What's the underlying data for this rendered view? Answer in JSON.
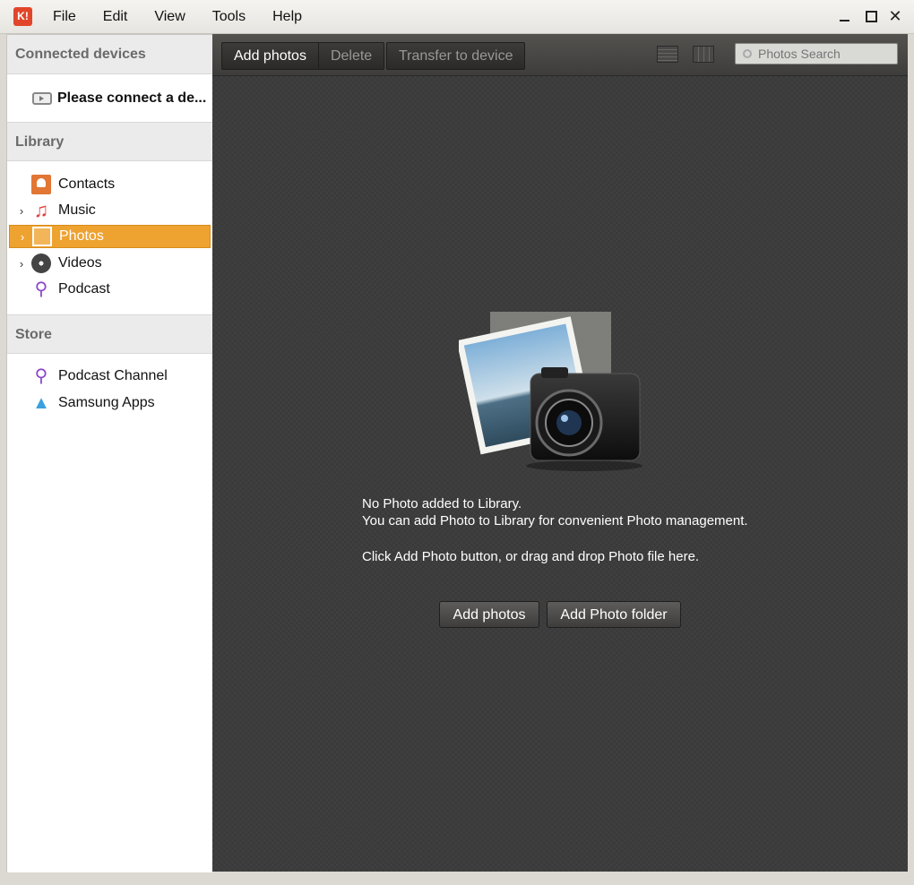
{
  "app": {
    "logo_text": "K!",
    "logo_color": "#e2462a"
  },
  "menu": [
    "File",
    "Edit",
    "View",
    "Tools",
    "Help"
  ],
  "window_controls": {
    "close_glyph": "✕"
  },
  "sidebar": {
    "connected_devices": {
      "header": "Connected devices",
      "device_label": "Please connect a de..."
    },
    "library": {
      "header": "Library",
      "items": [
        {
          "label": "Contacts",
          "icon": "contacts-icon",
          "expandable": false,
          "active": false
        },
        {
          "label": "Music",
          "icon": "music-icon",
          "glyph": "♫",
          "expandable": true,
          "active": false
        },
        {
          "label": "Photos",
          "icon": "photos-icon",
          "expandable": true,
          "active": true
        },
        {
          "label": "Videos",
          "icon": "videos-icon",
          "expandable": true,
          "active": false
        },
        {
          "label": "Podcast",
          "icon": "podcast-icon",
          "glyph": "⚲",
          "expandable": false,
          "active": false
        }
      ]
    },
    "store": {
      "header": "Store",
      "items": [
        {
          "label": "Podcast Channel",
          "icon": "podcast-icon",
          "glyph": "⚲"
        },
        {
          "label": "Samsung Apps",
          "icon": "samsung-apps-icon",
          "glyph": "▲"
        }
      ]
    },
    "chevron": "›",
    "accent_color": "#eea230"
  },
  "toolbar": {
    "add_photos": "Add photos",
    "delete": "Delete",
    "transfer": "Transfer to device",
    "search_placeholder": "Photos Search"
  },
  "empty_state": {
    "line1": "No Photo added to Library.",
    "line2": "You can add Photo to Library for convenient Photo management.",
    "line3": "Click Add Photo button, or drag and drop Photo file here.",
    "add_photos_button": "Add photos",
    "add_folder_button": "Add Photo folder"
  }
}
